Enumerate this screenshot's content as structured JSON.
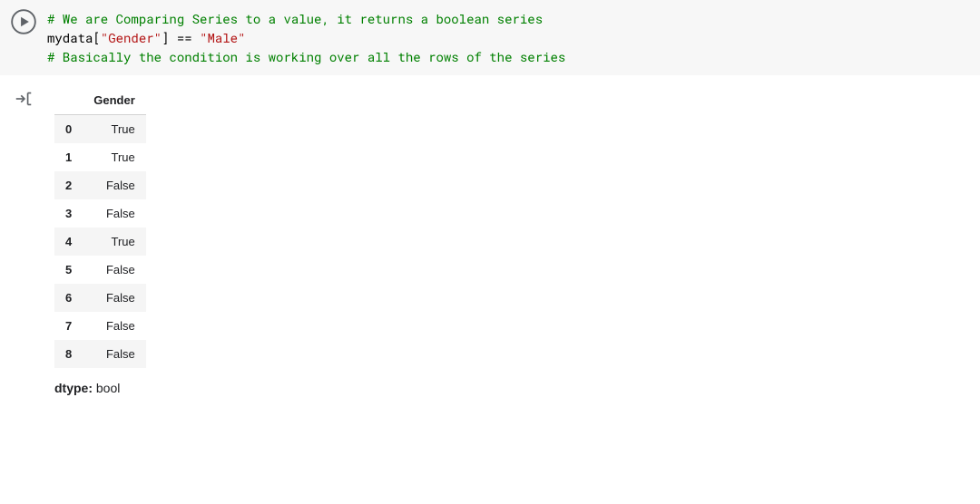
{
  "code": {
    "line1_comment": "# We are Comparing Series to a value, it returns a boolean series",
    "line2_var": "mydata",
    "line2_bracket_open": "[",
    "line2_key": "\"Gender\"",
    "line2_bracket_close": "]",
    "line2_op": " == ",
    "line2_value": "\"Male\"",
    "line3_comment": "# Basically the condition is working over all the rows of the series"
  },
  "output": {
    "column_header": "Gender",
    "rows": [
      {
        "idx": "0",
        "val": "True"
      },
      {
        "idx": "1",
        "val": "True"
      },
      {
        "idx": "2",
        "val": "False"
      },
      {
        "idx": "3",
        "val": "False"
      },
      {
        "idx": "4",
        "val": "True"
      },
      {
        "idx": "5",
        "val": "False"
      },
      {
        "idx": "6",
        "val": "False"
      },
      {
        "idx": "7",
        "val": "False"
      },
      {
        "idx": "8",
        "val": "False"
      }
    ],
    "dtype_label": "dtype:",
    "dtype_value": " bool"
  }
}
